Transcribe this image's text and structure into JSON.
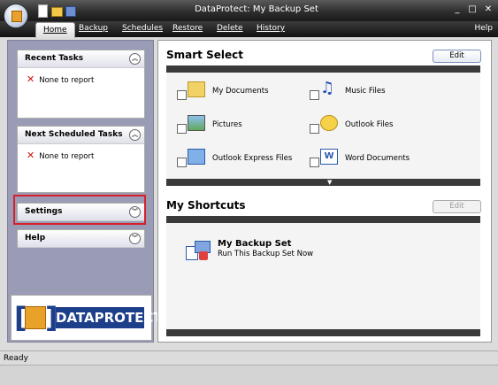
{
  "window": {
    "title": "DataProtect: My Backup Set",
    "controls": [
      "minimize",
      "maximize",
      "close"
    ]
  },
  "menu": {
    "items": [
      "Home",
      "Backup",
      "Schedules",
      "Restore",
      "Delete",
      "History"
    ],
    "active": "Home",
    "help": "Help"
  },
  "left_panel": {
    "recent_tasks": {
      "title": "Recent Tasks",
      "item": "None to report"
    },
    "scheduled_tasks": {
      "title": "Next Scheduled Tasks",
      "item": "None to report"
    },
    "settings": {
      "title": "Settings"
    },
    "help": {
      "title": "Help"
    },
    "logo": {
      "text": "DATAPROTECT",
      "left_bracket": "[",
      "right_bracket": "]"
    }
  },
  "smart_select": {
    "title": "Smart Select",
    "edit_label": "Edit",
    "items": [
      {
        "label": "My Documents",
        "icon": "folder-icon"
      },
      {
        "label": "Music Files",
        "icon": "music-note-icon"
      },
      {
        "label": "Pictures",
        "icon": "picture-icon"
      },
      {
        "label": "Outlook Files",
        "icon": "outlook-icon"
      },
      {
        "label": "Outlook Express Files",
        "icon": "outlook-express-icon"
      },
      {
        "label": "Word Documents",
        "icon": "word-document-icon"
      }
    ],
    "scroll_indicator": "▼"
  },
  "shortcuts": {
    "title": "My Shortcuts",
    "edit_label": "Edit",
    "item": {
      "title": "My Backup Set",
      "description": "Run This Backup Set Now"
    }
  },
  "status": {
    "text": "Ready"
  },
  "colors": {
    "highlight": "#d8202a",
    "title_bar": "#2e2e2e",
    "logo_blue": "#1d3f8a",
    "logo_orange": "#e8a22a"
  }
}
